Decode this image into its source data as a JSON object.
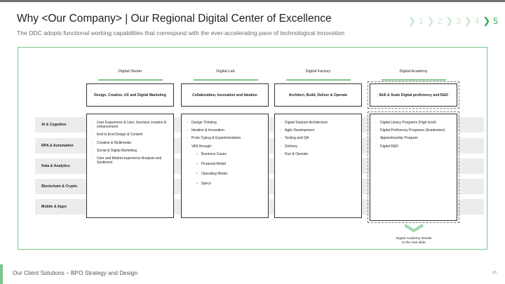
{
  "header": {
    "title": "Why <Our Company> | Our Regional Digital Center of Excellence",
    "subtitle": "The DDC adopts functional working capabilities that correspond with the ever-accelerating pace of technological innovation"
  },
  "steps": {
    "items": [
      "1",
      "2",
      "3",
      "4",
      "5"
    ],
    "active": "5"
  },
  "columns": [
    {
      "name": "Digital Studio",
      "box": "Design, Creative, UX and Digital Marketing",
      "items": [
        {
          "text": "User Experience & User Journeys creation & enhancement"
        },
        {
          "text": "End to End Design & Content"
        },
        {
          "text": "Creative & Multimedia"
        },
        {
          "text": "Social & Digital Marketing"
        },
        {
          "text": "User and Market experience Analysis and Sentiment"
        }
      ]
    },
    {
      "name": "Digital Lab",
      "box": "Collaboration, Innovation and Ideation",
      "items": [
        {
          "text": "Design Thinking"
        },
        {
          "text": "Ideation & Innovation"
        },
        {
          "text": "Proto Typing & Experimentation"
        },
        {
          "text": "VAS through:"
        },
        {
          "text": "Business Cases",
          "sub": true
        },
        {
          "text": "Financial Model",
          "sub": true
        },
        {
          "text": "Operating Model",
          "sub": true
        },
        {
          "text": "Specs",
          "sub": true
        }
      ]
    },
    {
      "name": "Digital Factory",
      "box": "Architect, Build, Deliver & Operate",
      "items": [
        {
          "text": "Digital Solution Architecture"
        },
        {
          "text": "Agile Development"
        },
        {
          "text": "Testing and QA"
        },
        {
          "text": "Delivery"
        },
        {
          "text": "Run & Operate"
        }
      ]
    },
    {
      "name": "Digital Academy",
      "box": "Skill & Scale Digital proficiency and R&D",
      "items": [
        {
          "text": "Digital Litracy Programs (High level)"
        },
        {
          "text": "Digital Proficiency Programs (Academies)"
        },
        {
          "text": "Apprenticeship Program"
        },
        {
          "text": "Digital R&D"
        }
      ]
    }
  ],
  "rows": [
    "AI & Cognitive",
    "RPA & Automation",
    "Data & Analytics",
    "Blockchain & Crypto",
    "Mobile & Apps"
  ],
  "note": {
    "line1": "Digital Academy Details",
    "line2": "in the next slide"
  },
  "footer": {
    "text": "Our Client Solutions – BPO Strategy and Design",
    "page": "86"
  },
  "colors": {
    "accent_green": "#2fa84f",
    "light_green": "#7cc48e",
    "band_gray": "#ececec"
  }
}
